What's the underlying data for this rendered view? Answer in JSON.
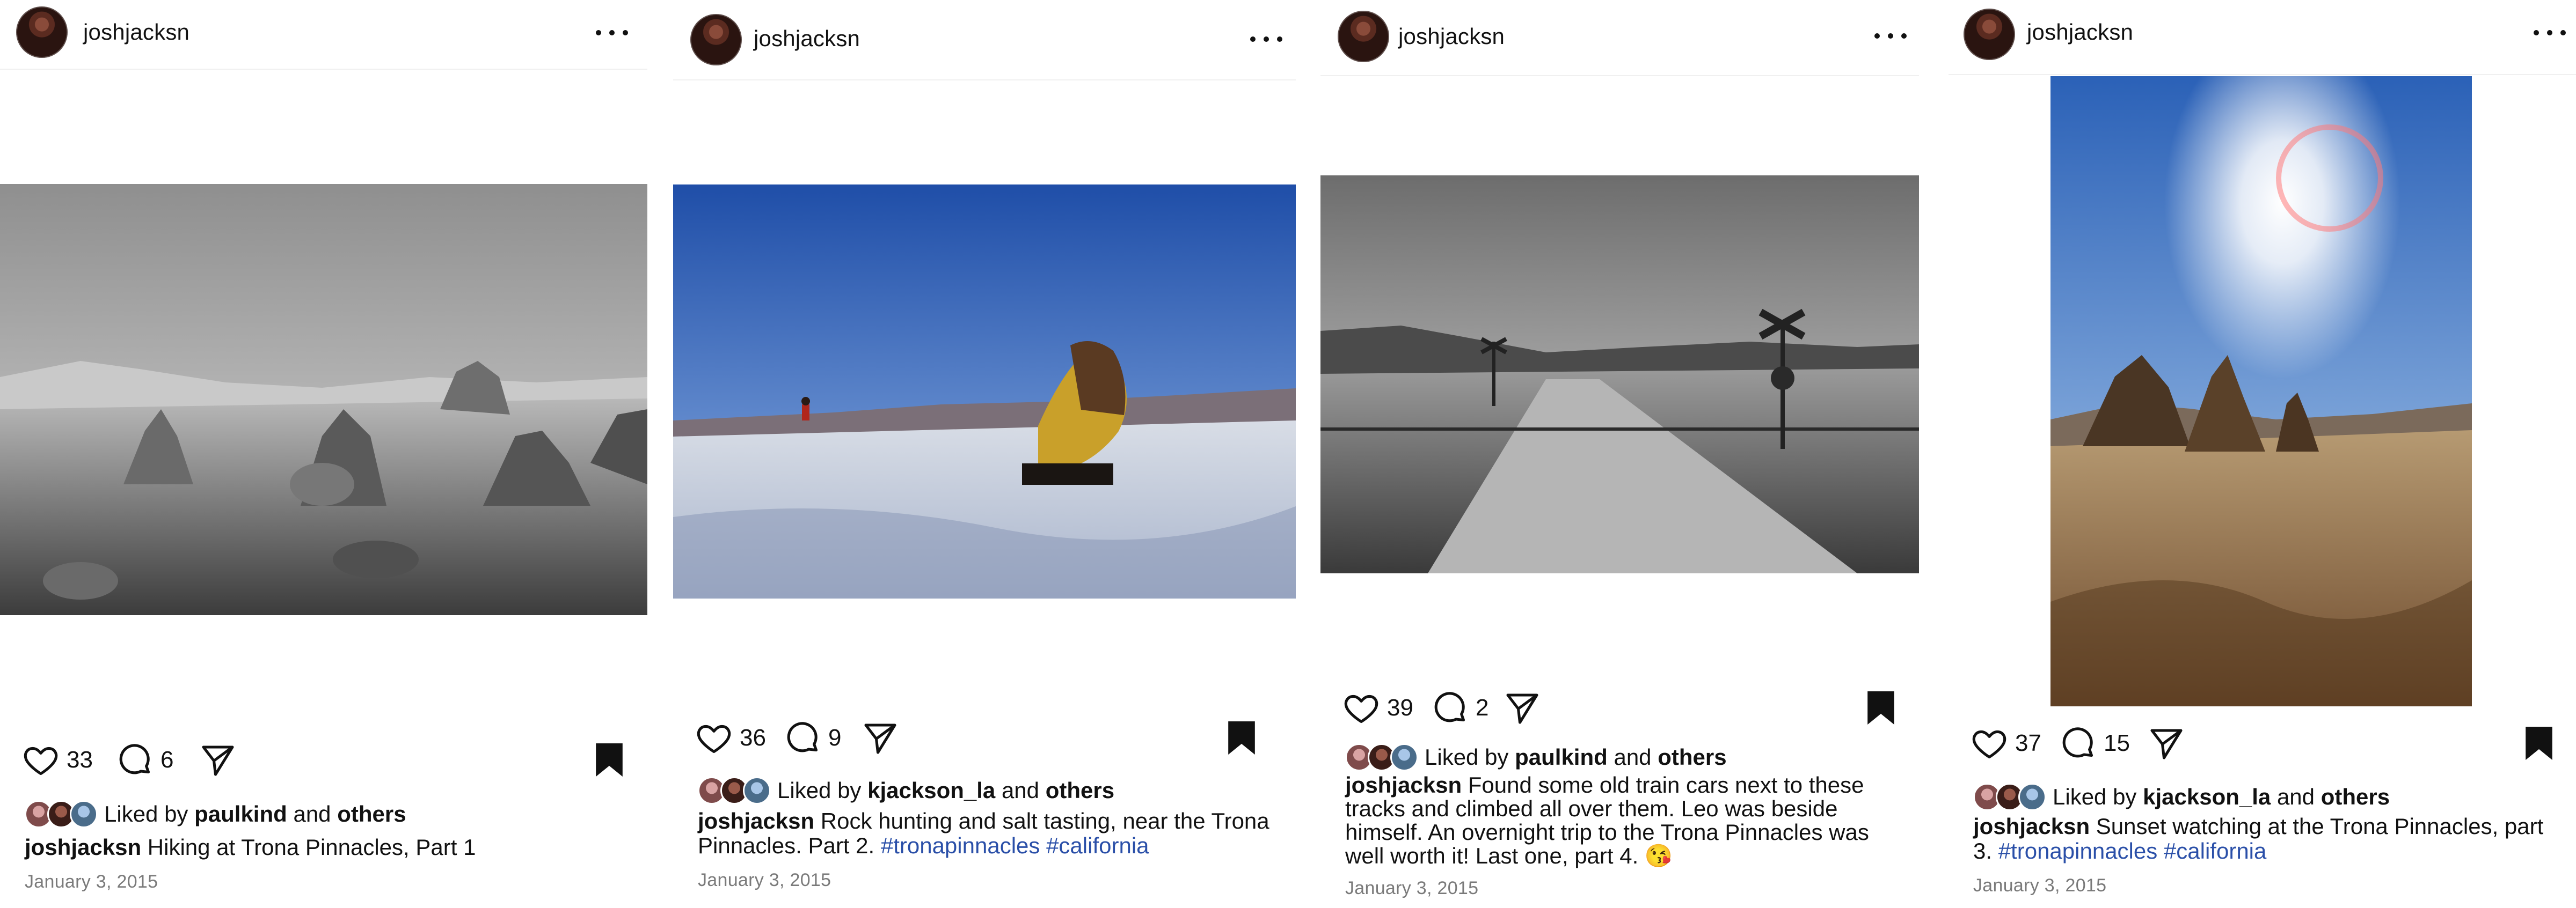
{
  "posts": [
    {
      "username": "joshjacksn",
      "likes": "33",
      "comments": "6",
      "liked_by_prefix": "Liked by",
      "liked_by_user": "paulkind",
      "liked_by_and": "and",
      "liked_by_others": "others",
      "caption_user": "joshjacksn",
      "caption_text": "Hiking at Trona Pinnacles, Part 1",
      "hashtags": [],
      "date": "January 3, 2015"
    },
    {
      "username": "joshjacksn",
      "likes": "36",
      "comments": "9",
      "liked_by_prefix": "Liked by",
      "liked_by_user": "kjackson_la",
      "liked_by_and": "and",
      "liked_by_others": "others",
      "caption_user": "joshjacksn",
      "caption_text": "Rock hunting and salt tasting, near the Trona Pinnacles. Part 2.",
      "hashtags": [
        "#tronapinnacles",
        "#california"
      ],
      "date": "January 3, 2015"
    },
    {
      "username": "joshjacksn",
      "likes": "39",
      "comments": "2",
      "liked_by_prefix": "Liked by",
      "liked_by_user": "paulkind",
      "liked_by_and": "and",
      "liked_by_others": "others",
      "caption_user": "joshjacksn",
      "caption_text": "Found some old train cars next to these tracks and climbed all over them. Leo was beside himself. An overnight trip to the Trona Pinnacles was well worth it! Last one, part 4. 😘",
      "hashtags": [],
      "date": "January 3, 2015"
    },
    {
      "username": "joshjacksn",
      "likes": "37",
      "comments": "15",
      "liked_by_prefix": "Liked by",
      "liked_by_user": "kjackson_la",
      "liked_by_and": "and",
      "liked_by_others": "others",
      "caption_user": "joshjacksn",
      "caption_text": "Sunset watching at the Trona Pinnacles, part 3.",
      "hashtags": [
        "#tronapinnacles",
        "#california"
      ],
      "date": "January 3, 2015"
    }
  ],
  "icons": {
    "like": "heart-outline-icon",
    "comment": "comment-bubble-icon",
    "share": "paper-plane-icon",
    "save": "bookmark-filled-icon",
    "more": "more-horizontal-icon"
  },
  "colors": {
    "text": "#111111",
    "hashtag": "#2a4fa8",
    "muted": "#7a7a7a",
    "divider": "#f0f0f0"
  }
}
